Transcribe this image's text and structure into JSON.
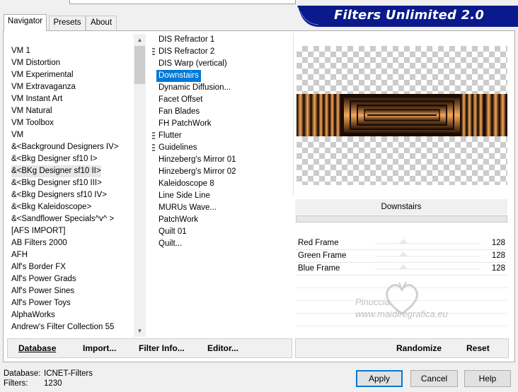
{
  "banner": {
    "title": "Filters Unlimited 2.0"
  },
  "tabs": [
    {
      "label": "Navigator",
      "active": true
    },
    {
      "label": "Presets",
      "active": false
    },
    {
      "label": "About",
      "active": false
    }
  ],
  "categories": [
    "VM 1",
    "VM Distortion",
    "VM Experimental",
    "VM Extravaganza",
    "VM Instant Art",
    "VM Natural",
    "VM Toolbox",
    "VM",
    "&<Background Designers IV>",
    "&<Bkg Designer sf10 I>",
    "&<BKg Designer sf10 II>",
    "&<Bkg Designer sf10 III>",
    "&<Bkg Designers sf10 IV>",
    "&<Bkg Kaleidoscope>",
    "&<Sandflower Specials^v^ >",
    "[AFS IMPORT]",
    "AB Filters 2000",
    "AFH",
    "Alf's Border FX",
    "Alf's Power Grads",
    "Alf's Power Sines",
    "Alf's Power Toys",
    "AlphaWorks",
    "Andrew's Filter Collection 55"
  ],
  "selected_category": "&<BKg Designer sf10 II>",
  "filters": [
    {
      "label": "DIS Refractor 1",
      "marker": false
    },
    {
      "label": "DIS Refractor 2",
      "marker": true
    },
    {
      "label": "DIS Warp (vertical)",
      "marker": false
    },
    {
      "label": "Downstairs",
      "marker": false
    },
    {
      "label": "Dynamic Diffusion...",
      "marker": false
    },
    {
      "label": "Facet Offset",
      "marker": false
    },
    {
      "label": "Fan Blades",
      "marker": false
    },
    {
      "label": "FH PatchWork",
      "marker": false
    },
    {
      "label": "Flutter",
      "marker": true
    },
    {
      "label": "Guidelines",
      "marker": true
    },
    {
      "label": "Hinzeberg's Mirror 01",
      "marker": false
    },
    {
      "label": "Hinzeberg's Mirror 02",
      "marker": false
    },
    {
      "label": "Kaleidoscope 8",
      "marker": false
    },
    {
      "label": "Line Side Line",
      "marker": false
    },
    {
      "label": "MURUs Wave...",
      "marker": false
    },
    {
      "label": "PatchWork",
      "marker": false
    },
    {
      "label": "Quilt 01",
      "marker": false
    },
    {
      "label": "Quilt...",
      "marker": false
    }
  ],
  "selected_filter": "Downstairs",
  "current_filter_title": "Downstairs",
  "params": [
    {
      "label": "Red Frame",
      "value": "128"
    },
    {
      "label": "Green Frame",
      "value": "128"
    },
    {
      "label": "Blue Frame",
      "value": "128"
    }
  ],
  "watermark": {
    "name": "Pinuccia",
    "url": "www.maidiregrafica.eu"
  },
  "toolbar_left": {
    "database": "Database",
    "import": "Import...",
    "filter_info": "Filter Info...",
    "editor": "Editor..."
  },
  "toolbar_right": {
    "randomize": "Randomize",
    "reset": "Reset"
  },
  "status": {
    "database_label": "Database:",
    "database_value": "ICNET-Filters",
    "filters_label": "Filters:",
    "filters_value": "1230"
  },
  "buttons": {
    "apply": "Apply",
    "cancel": "Cancel",
    "help": "Help"
  },
  "colors": {
    "banner": "#0a1a8c",
    "selection": "#0078d7",
    "frame_light": "#f5a85a",
    "frame_dark": "#2a1405"
  }
}
